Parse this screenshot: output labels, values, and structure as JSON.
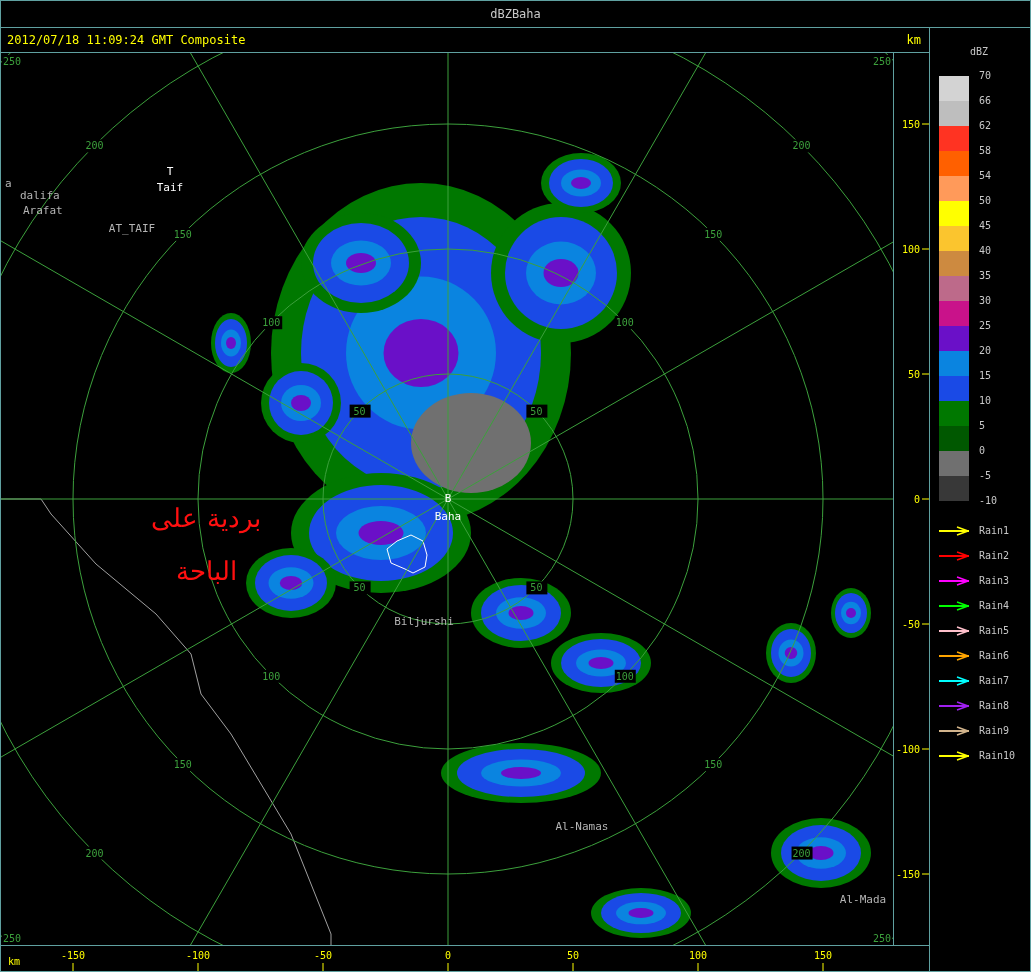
{
  "window": {
    "title": "dBZBaha"
  },
  "header": {
    "timestamp": "2012/07/18 11:09:24 GMT Composite",
    "unit": "km"
  },
  "map": {
    "rings": [
      {
        "labels": [
          "50",
          "50",
          "50",
          "50"
        ]
      },
      {
        "labels": [
          "100",
          "100",
          "100",
          "100"
        ]
      },
      {
        "labels": [
          "150",
          "150",
          "150",
          "150"
        ]
      },
      {
        "labels": [
          "200",
          "200",
          "200",
          "200"
        ]
      },
      {
        "labels": [
          "250",
          "250",
          "250",
          "250"
        ]
      }
    ],
    "places": [
      {
        "text": "T",
        "kind": "station"
      },
      {
        "text": "Taif",
        "kind": "station"
      },
      {
        "text": "a",
        "kind": "town"
      },
      {
        "text": "dalifa",
        "kind": "town"
      },
      {
        "text": "Arafat",
        "kind": "town"
      },
      {
        "text": "AT_TAIF",
        "kind": "town"
      },
      {
        "text": "B",
        "kind": "station"
      },
      {
        "text": "Baha",
        "kind": "station"
      },
      {
        "text": "Biljurshi",
        "kind": "town"
      },
      {
        "text": "Al-Namas",
        "kind": "town"
      },
      {
        "text": "Al-Mada",
        "kind": "town"
      }
    ],
    "annotation": [
      "بردية على",
      "الباحة"
    ]
  },
  "y_axis": {
    "ticks": [
      "150",
      "100",
      "50",
      "0",
      "-50",
      "-100",
      "-150"
    ]
  },
  "x_axis": {
    "unit": "km",
    "ticks": [
      "-150",
      "-100",
      "-50",
      "0",
      "50",
      "100",
      "150"
    ]
  },
  "legend": {
    "title": "dBZ",
    "bands": [
      {
        "color": "#d3d3d3"
      },
      {
        "color": "#bebebe"
      },
      {
        "color": "#ff3322"
      },
      {
        "color": "#ff6000"
      },
      {
        "color": "#ff9a5a"
      },
      {
        "color": "#ffff00"
      },
      {
        "color": "#fbc52e"
      },
      {
        "color": "#cd8a40"
      },
      {
        "color": "#bd6a8a"
      },
      {
        "color": "#c9128a"
      },
      {
        "color": "#6a10c8"
      },
      {
        "color": "#0a84e0"
      },
      {
        "color": "#1a4ae6"
      },
      {
        "color": "#007800"
      },
      {
        "color": "#005800"
      },
      {
        "color": "#707070"
      },
      {
        "color": "#383838"
      }
    ],
    "ticks": [
      "70",
      "66",
      "62",
      "58",
      "54",
      "50",
      "45",
      "40",
      "35",
      "30",
      "25",
      "20",
      "15",
      "10",
      "5",
      "0",
      "-5",
      "-10"
    ],
    "tracks": [
      {
        "label": "Rain1",
        "color": "#ffff00"
      },
      {
        "label": "Rain2",
        "color": "#ff0000"
      },
      {
        "label": "Rain3",
        "color": "#ff00ff"
      },
      {
        "label": "Rain4",
        "color": "#00ff00"
      },
      {
        "label": "Rain5",
        "color": "#ffc0cb"
      },
      {
        "label": "Rain6",
        "color": "#ffa500"
      },
      {
        "label": "Rain7",
        "color": "#00ffff"
      },
      {
        "label": "Rain8",
        "color": "#a020f0"
      },
      {
        "label": "Rain9",
        "color": "#d2b48c"
      },
      {
        "label": "Rain10",
        "color": "#ffff00"
      }
    ]
  }
}
